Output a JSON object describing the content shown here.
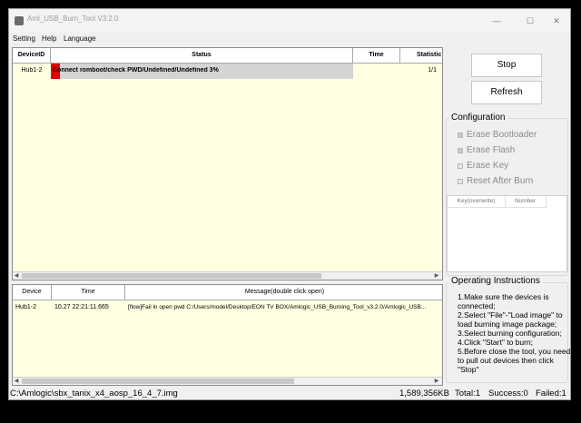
{
  "window": {
    "title": "Aml_USB_Burn_Tool V3.2.0",
    "minimize_glyph": "—",
    "maximize_glyph": "☐",
    "close_glyph": "✕"
  },
  "menu": [
    "Setting",
    "Help",
    "Language"
  ],
  "device_table": {
    "headers": [
      "DeviceID",
      "Status",
      "Time",
      "Statistic"
    ],
    "rows": [
      {
        "device_id": "Hub1-2",
        "status": "Connect romboot/check PWD/Undefined/Undefined 3%",
        "time": "",
        "statistic": "1/1"
      }
    ],
    "progress_percent": 3
  },
  "log_table": {
    "headers": [
      "Device",
      "Time",
      "Message(double click open)"
    ],
    "rows": [
      {
        "device": "Hub1-2",
        "time": "10.27 22:21:11.665",
        "message": "[flow]Fail in open pwd C:/Users/model/Desktop/EON TV BOX/Amlogic_USB_Burning_Tool_v3.2.0/Amlogic_USB..."
      }
    ]
  },
  "buttons": {
    "stop": "Stop",
    "refresh": "Refresh"
  },
  "configuration": {
    "title": "Configuration",
    "options": [
      "Erase Bootloader",
      "Erase Flash",
      "Erase Key",
      "Reset After Burn"
    ],
    "checked": [
      true,
      true,
      false,
      false
    ],
    "key_headers": [
      "Key(overwrite)",
      "Number"
    ]
  },
  "instructions": {
    "title": "Operating Instructions",
    "text": "1.Make sure the devices is connected;\n2.Select \"File\"-\"Load image\" to load burning image package;\n3.Select burning configuration;\n4.Click \"Start\" to burn;\n5.Before close the tool, you need to pull out devices then click \"Stop\""
  },
  "status_bar": {
    "image_path": "C:\\Amlogic\\sbx_tanix_x4_aosp_16_4_7.img",
    "size": "1,589,356KB",
    "total": "Total:1",
    "success": "Success:0",
    "failed": "Failed:1"
  },
  "colors": {
    "grid_bg": "#ffffe1",
    "progress": "#e00000",
    "status_highlight": "#d4d4d4"
  }
}
